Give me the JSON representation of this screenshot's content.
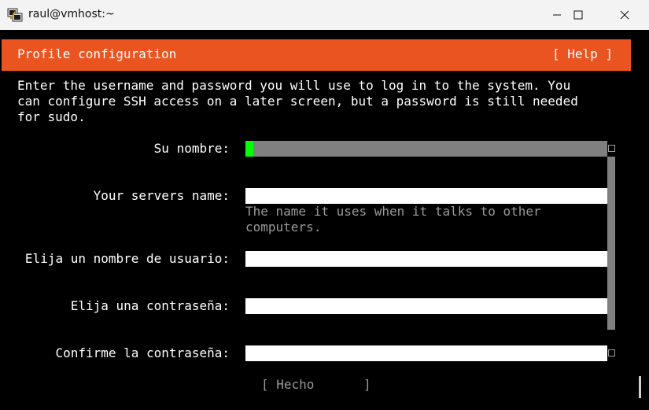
{
  "window": {
    "title": "raul@vmhost:~",
    "app_icon": "putty-icon",
    "controls": [
      "minimize-icon",
      "maximize-icon",
      "close-icon"
    ]
  },
  "header": {
    "title": "Profile configuration",
    "help": "[ Help ]",
    "color": "#e95420"
  },
  "description": "Enter the username and password you will use to log in to the system. You\ncan configure SSH access on a later screen, but a password is still needed\nfor sudo.",
  "form": {
    "name_label": "Su nombre:",
    "name_value": "",
    "server_label": "Your servers name:",
    "server_value": "",
    "server_hint": "The name it uses when it talks to other\ncomputers.",
    "username_label": "Elija un nombre de usuario:",
    "username_value": "",
    "password_label": "Elija una contraseña:",
    "password_value": "",
    "confirm_label": "Confirme la contraseña:",
    "confirm_value": ""
  },
  "done_button": {
    "open": "[ Hecho",
    "close": "]"
  },
  "colors": {
    "cursor": "#00ff00",
    "active_field": "#808080"
  }
}
